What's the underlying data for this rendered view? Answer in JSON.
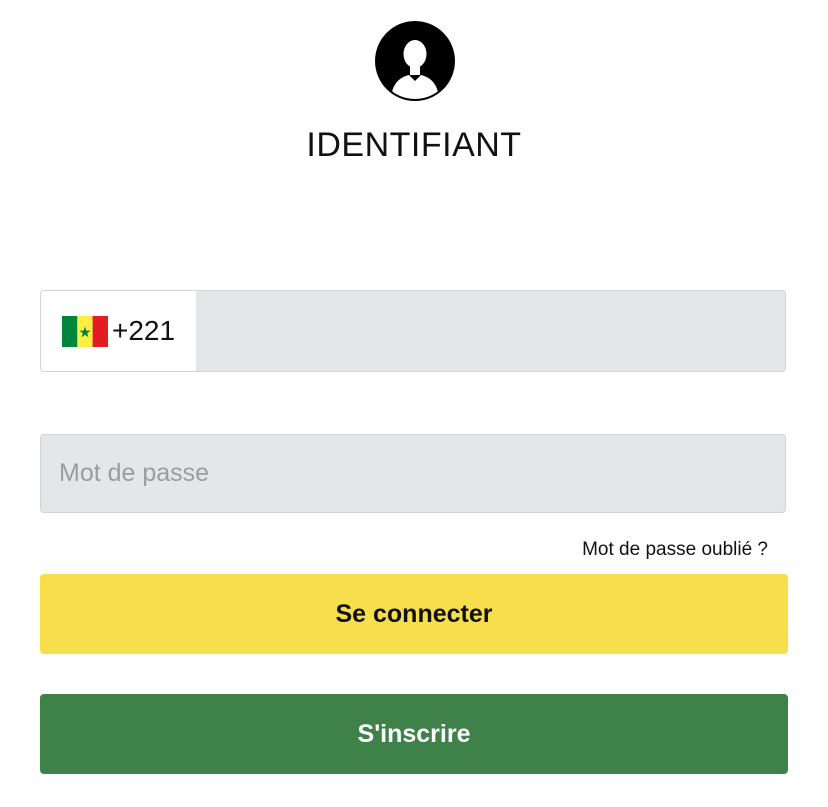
{
  "header": {
    "avatar_icon": "user-avatar-icon",
    "title": "IDENTIFIANT"
  },
  "phone": {
    "country_flag": "senegal-flag-icon",
    "flag_colors": [
      "#00853f",
      "#fdef42",
      "#e31b23"
    ],
    "dial_code": "+221",
    "value": "",
    "placeholder": ""
  },
  "password": {
    "value": "",
    "placeholder": "Mot de passe"
  },
  "links": {
    "forgot_password": "Mot de passe oublié ?"
  },
  "buttons": {
    "login_label": "Se connecter",
    "login_color": "#f7de4c",
    "signup_label": "S'inscrire",
    "signup_color": "#3e8249"
  }
}
